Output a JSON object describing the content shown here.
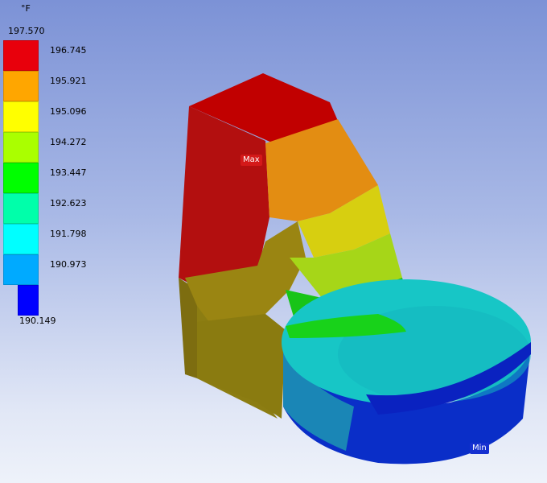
{
  "legend": {
    "unit": "°F",
    "max_label": "197.570",
    "min_label": "190.149",
    "bands": [
      {
        "value": "196.745",
        "color": "#e8000c"
      },
      {
        "value": "195.921",
        "color": "#ffa600"
      },
      {
        "value": "195.096",
        "color": "#ffff00"
      },
      {
        "value": "194.272",
        "color": "#aaff00"
      },
      {
        "value": "193.447",
        "color": "#00ff00"
      },
      {
        "value": "192.623",
        "color": "#00ffaa"
      },
      {
        "value": "191.798",
        "color": "#00ffff"
      },
      {
        "value": "190.973",
        "color": "#00aaff"
      },
      {
        "value": "",
        "color": "#0000ff"
      }
    ]
  },
  "probes": {
    "max_label": "Max",
    "min_label": "Min"
  }
}
